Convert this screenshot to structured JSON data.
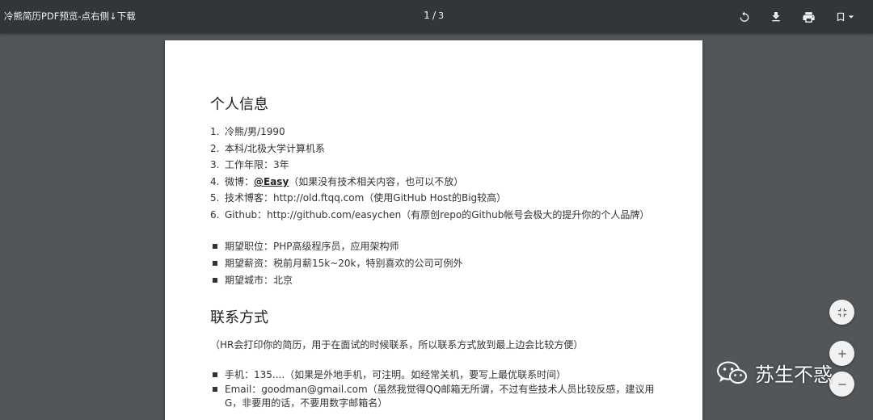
{
  "toolbar": {
    "title": "冷熊简历PDF预览-点右侧↓下载",
    "page_current": "1",
    "page_sep": "/",
    "page_total": "3",
    "icons": [
      "rotate-icon",
      "download-icon",
      "print-icon",
      "bookmark-icon",
      "chevron-down-icon"
    ]
  },
  "resume": {
    "section1_title": "个人信息",
    "info_items": [
      {
        "num": "1.",
        "text": "冷熊/男/1990"
      },
      {
        "num": "2.",
        "text": "本科/北极大学计算机系"
      },
      {
        "num": "3.",
        "text": "工作年限：3年"
      },
      {
        "num": "4.",
        "prefix": "微博：",
        "link": "@Easy",
        "suffix": "（如果没有技术相关内容，也可以不放）"
      },
      {
        "num": "5.",
        "text": "技术博客：http://old.ftqq.com（使用GitHub Host的Big较高）"
      },
      {
        "num": "6.",
        "text": "Github：http://github.com/easychen（有原创repo的Github帐号会极大的提升你的个人品牌）"
      }
    ],
    "expect_items": [
      "期望职位：PHP高级程序员，应用架构师",
      "期望薪资：税前月薪15k~20k，特别喜欢的公司可例外",
      "期望城市：北京"
    ],
    "section2_title": "联系方式",
    "contact_note": "（HR会打印你的简历，用于在面试的时候联系，所以联系方式放到最上边会比较方便）",
    "contact_items": [
      "手机：135....（如果是外地手机，可注明。如经常关机，要写上最优联系时间）",
      "Email：goodman@gmail.com（虽然我觉得QQ邮箱无所谓，不过有些技术人员比较反感，建议用G，非要用的话，不要用数字邮箱名）"
    ]
  },
  "controls": {
    "icons": [
      "fit-page-icon",
      "zoom-in-icon",
      "zoom-out-icon"
    ]
  },
  "watermark": {
    "text": "苏生不惑",
    "icon": "wechat-icon"
  }
}
